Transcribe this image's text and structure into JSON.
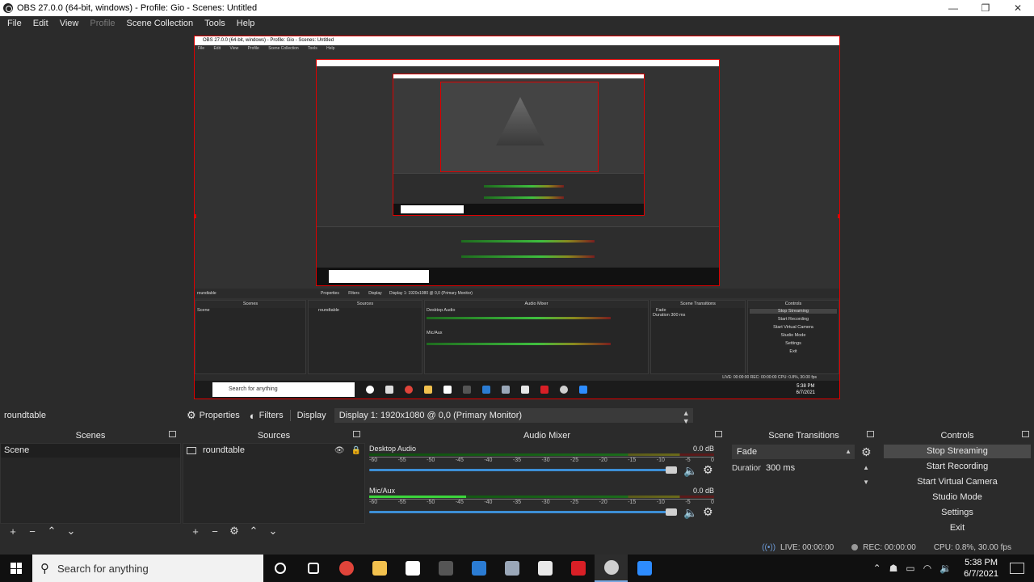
{
  "window": {
    "title": "OBS 27.0.0 (64-bit, windows) - Profile: Gio - Scenes: Untitled",
    "minimize": "—",
    "maximize": "❐",
    "close": "✕"
  },
  "menu": [
    "File",
    "Edit",
    "View",
    "Profile",
    "Scene Collection",
    "Tools",
    "Help"
  ],
  "preview": {
    "inner_title": "OBS 27.0.0 (64-bit, windows) - Profile: Gio - Scenes: Untitled",
    "inner_menu": [
      "File",
      "Edit",
      "View",
      "Profile",
      "Scene Collection",
      "Tools",
      "Help"
    ],
    "inner_source_name": "roundtable",
    "inner_toolbar": [
      "Properties",
      "Filters",
      "Display",
      "Display 1: 1920x1080 @ 0,0 (Primary Monitor)"
    ],
    "inner_docks": [
      "Scenes",
      "Sources",
      "Audio Mixer",
      "Scene Transitions",
      "Controls"
    ],
    "inner_scene": "Scene",
    "inner_source": "roundtable",
    "inner_channels": [
      "Desktop Audio",
      "Mic/Aux"
    ],
    "inner_transition": "Fade",
    "inner_duration_label": "Duration",
    "inner_duration": "300 ms",
    "inner_controls": [
      "Stop Streaming",
      "Start Recording",
      "Start Virtual Camera",
      "Studio Mode",
      "Settings",
      "Exit"
    ],
    "inner_status": "LIVE: 00:00:00   REC: 00:00:00   CPU: 0.8%, 30.00 fps",
    "inner_search": "Search for anything",
    "inner_clock_time": "5:38 PM",
    "inner_clock_date": "6/7/2021"
  },
  "source_toolbar": {
    "source_name": "roundtable",
    "properties": "Properties",
    "filters": "Filters",
    "display_label": "Display",
    "display_value": "Display 1: 1920x1080 @ 0,0 (Primary Monitor)"
  },
  "scenes": {
    "header": "Scenes",
    "items": [
      "Scene"
    ]
  },
  "sources": {
    "header": "Sources",
    "items": [
      "roundtable"
    ]
  },
  "mixer": {
    "header": "Audio Mixer",
    "ticks": [
      "-60",
      "-55",
      "-50",
      "-45",
      "-40",
      "-35",
      "-30",
      "-25",
      "-20",
      "-15",
      "-10",
      "-5",
      "0"
    ],
    "channels": [
      {
        "name": "Desktop Audio",
        "db": "0.0 dB",
        "level": 0
      },
      {
        "name": "Mic/Aux",
        "db": "0.0 dB",
        "level": 0.28
      }
    ]
  },
  "transitions": {
    "header": "Scene Transitions",
    "selected": "Fade",
    "duration_label": "Duration",
    "duration": "300 ms"
  },
  "controls": {
    "header": "Controls",
    "buttons": [
      "Stop Streaming",
      "Start Recording",
      "Start Virtual Camera",
      "Studio Mode",
      "Settings",
      "Exit"
    ]
  },
  "status": {
    "live": "LIVE: 00:00:00",
    "rec": "REC: 00:00:00",
    "cpu": "CPU: 0.8%, 30.00 fps"
  },
  "taskbar": {
    "search_placeholder": "Search for anything",
    "time": "5:38 PM",
    "date": "6/7/2021",
    "apps": [
      {
        "name": "cortana-icon",
        "color": "#ffffff"
      },
      {
        "name": "task-view-icon",
        "color": "#ffffff"
      },
      {
        "name": "chrome-icon",
        "color": "#e0443a"
      },
      {
        "name": "file-explorer-icon",
        "color": "#f2c14e"
      },
      {
        "name": "store-icon",
        "color": "#ffffff"
      },
      {
        "name": "onenote-icon",
        "color": "#555555"
      },
      {
        "name": "mail-icon",
        "color": "#2b7cd3"
      },
      {
        "name": "camera-icon",
        "color": "#9aa7b8"
      },
      {
        "name": "calculator-icon",
        "color": "#e8e8e8"
      },
      {
        "name": "netflix-icon",
        "color": "#d81f26"
      },
      {
        "name": "obs-icon",
        "color": "#cfcfcf"
      },
      {
        "name": "zoom-icon",
        "color": "#2d8cff"
      }
    ]
  }
}
